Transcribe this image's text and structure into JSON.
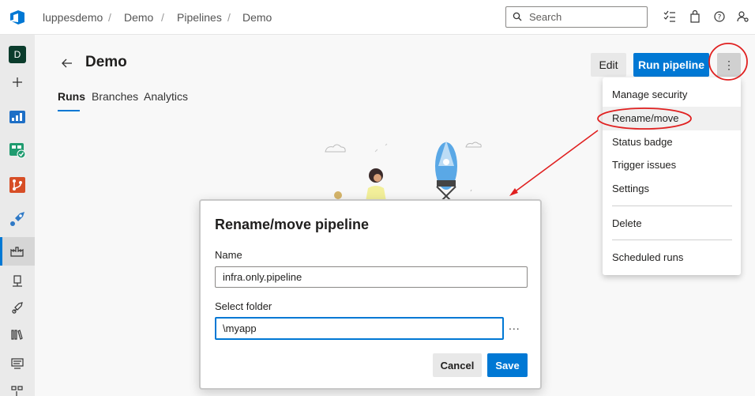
{
  "breadcrumbs": [
    "luppesdemo",
    "Demo",
    "Pipelines",
    "Demo"
  ],
  "search": {
    "placeholder": "Search"
  },
  "top_icons": [
    "task-list-icon",
    "shopping-bag-icon",
    "help-icon",
    "user-settings-icon"
  ],
  "left_nav": {
    "avatar_letter": "D",
    "items": [
      "add-icon",
      "overview-icon",
      "boards-icon",
      "repos-icon",
      "pipelines-icon",
      "pipelines-runs-icon",
      "environments-icon",
      "releases-icon",
      "library-icon",
      "task-groups-icon",
      "deployment-groups-icon"
    ]
  },
  "page": {
    "title": "Demo",
    "tabs": [
      {
        "label": "Runs",
        "active": true
      },
      {
        "label": "Branches",
        "active": false
      },
      {
        "label": "Analytics",
        "active": false
      }
    ]
  },
  "toolbar": {
    "edit_label": "Edit",
    "run_label": "Run pipeline",
    "more_label": "⋮"
  },
  "menu": {
    "items": [
      "Manage security",
      "Rename/move",
      "Status badge",
      "Trigger issues",
      "Settings",
      "Delete",
      "Scheduled runs"
    ]
  },
  "dialog": {
    "title": "Rename/move pipeline",
    "name_label": "Name",
    "name_value": "infra.only.pipeline",
    "folder_label": "Select folder",
    "folder_value": "\\myapp",
    "browse_label": "...",
    "cancel_label": "Cancel",
    "save_label": "Save"
  },
  "colors": {
    "accent": "#0078d4",
    "annotation": "#e02020"
  }
}
